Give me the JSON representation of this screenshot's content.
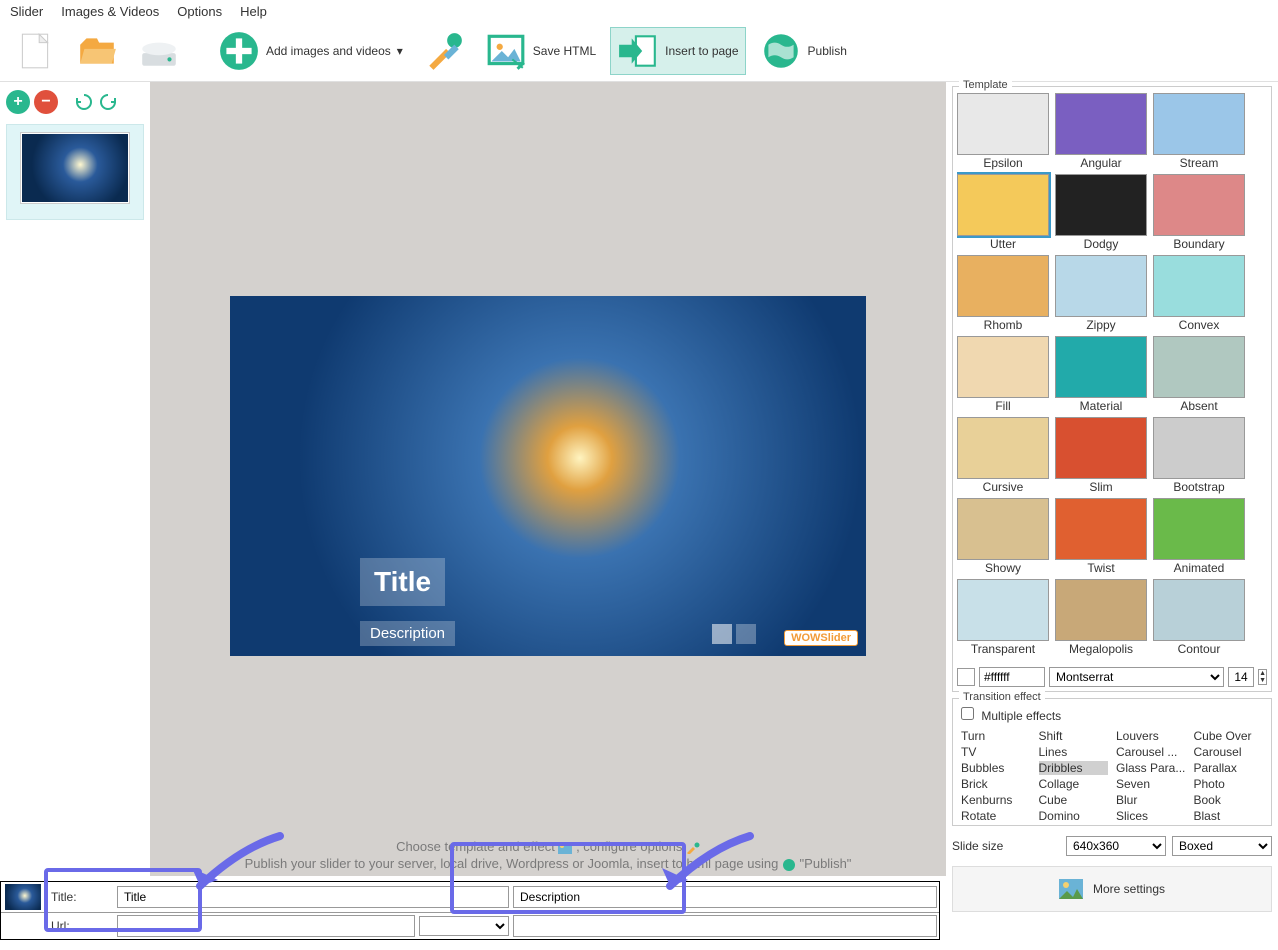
{
  "menu": {
    "items": [
      "Slider",
      "Images & Videos",
      "Options",
      "Help"
    ]
  },
  "toolbar": {
    "add_label": "Add images and videos",
    "save_label": "Save HTML",
    "insert_label": "Insert to page",
    "publish_label": "Publish"
  },
  "preview": {
    "title": "Title",
    "description": "Description",
    "watermark": "WOWSlider"
  },
  "hints": {
    "line1_a": "Choose template and effect",
    "line1_b": ", configure options",
    "line2_a": "Publish your slider to your server, local drive, Wordpress or Joomla, insert to html page using",
    "line2_b": "\"Publish\""
  },
  "templates": {
    "group_label": "Template",
    "items": [
      "Epsilon",
      "Angular",
      "Stream",
      "Utter",
      "Dodgy",
      "Boundary",
      "Rhomb",
      "Zippy",
      "Convex",
      "Fill",
      "Material",
      "Absent",
      "Cursive",
      "Slim",
      "Bootstrap",
      "Showy",
      "Twist",
      "Animated",
      "Transparent",
      "Megalopolis",
      "Contour"
    ],
    "selected": "Utter",
    "color": "#ffffff",
    "font": "Montserrat",
    "font_size": "14"
  },
  "transition": {
    "group_label": "Transition effect",
    "multiple_label": "Multiple effects",
    "items": [
      "Turn",
      "Shift",
      "Louvers",
      "Cube Over",
      "TV",
      "Lines",
      "Carousel ...",
      "Carousel",
      "Bubbles",
      "Dribbles",
      "Glass Para...",
      "Parallax",
      "Brick",
      "Collage",
      "Seven",
      "Photo",
      "Kenburns",
      "Cube",
      "Blur",
      "Book",
      "Rotate",
      "Domino",
      "Slices",
      "Blast"
    ],
    "selected": "Dribbles"
  },
  "size": {
    "label": "Slide size",
    "value": "640x360",
    "mode": "Boxed"
  },
  "more_settings": "More settings",
  "bottom": {
    "title_label": "Title:",
    "title_value": "Title",
    "desc_value": "Description",
    "url_label": "Url:"
  }
}
